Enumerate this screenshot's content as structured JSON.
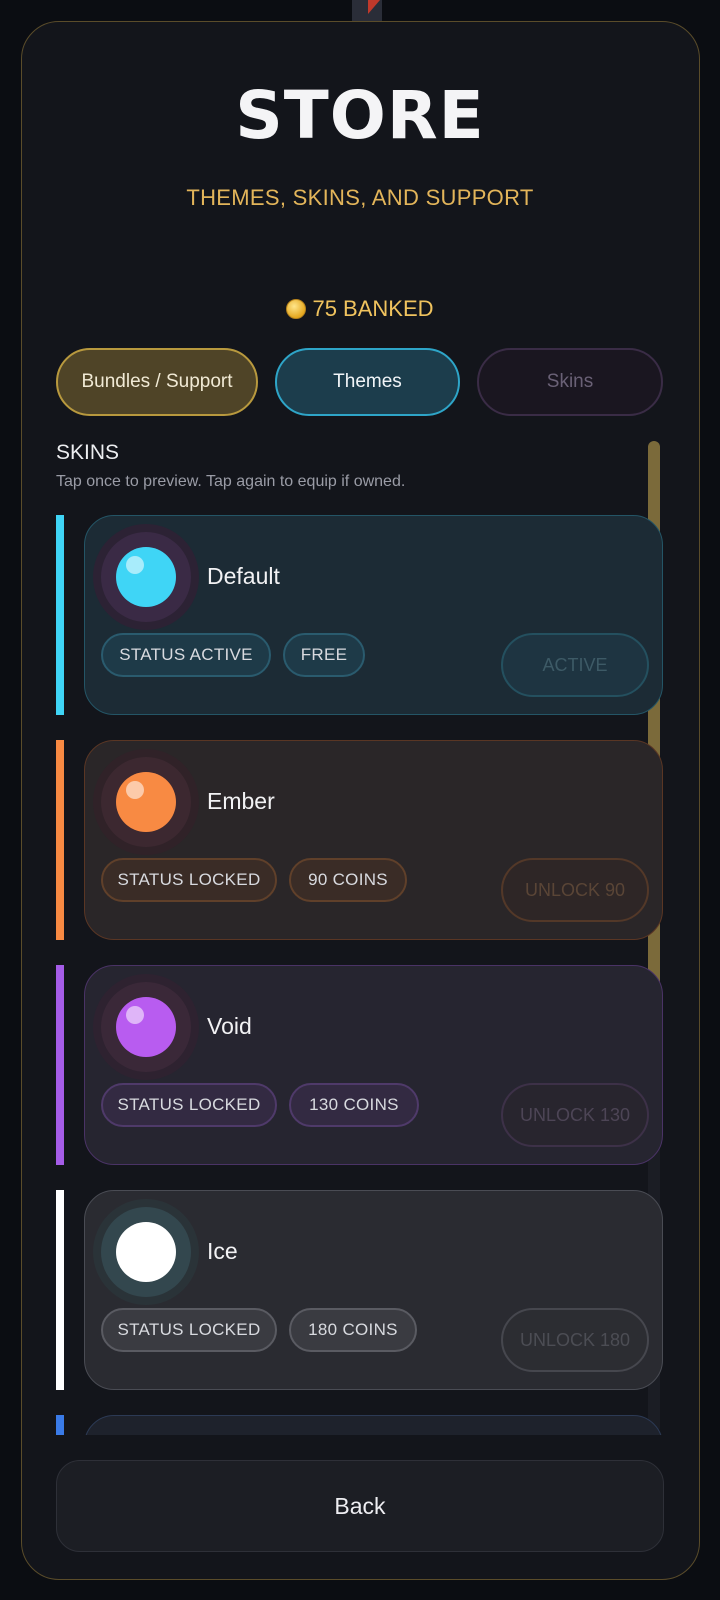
{
  "header": {
    "title": "STORE",
    "subtitle": "THEMES, SKINS, AND SUPPORT",
    "banked": "75 BANKED"
  },
  "tabs": [
    {
      "label": "Bundles / Support"
    },
    {
      "label": "Themes"
    },
    {
      "label": "Skins"
    }
  ],
  "section": {
    "title": "SKINS",
    "hint": "Tap once to preview. Tap again to equip if owned."
  },
  "skins": [
    {
      "name": "Default",
      "status": "STATUS ACTIVE",
      "price": "FREE",
      "action": "ACTIVE",
      "color": "#3fd5f6"
    },
    {
      "name": "Ember",
      "status": "STATUS LOCKED",
      "price": "90 COINS",
      "action": "UNLOCK 90",
      "color": "#f88a43"
    },
    {
      "name": "Void",
      "status": "STATUS LOCKED",
      "price": "130 COINS",
      "action": "UNLOCK 130",
      "color": "#b85cf0"
    },
    {
      "name": "Ice",
      "status": "STATUS LOCKED",
      "price": "180 COINS",
      "action": "UNLOCK 180",
      "color": "#ffffff"
    },
    {
      "name": "",
      "status": "",
      "price": "",
      "action": "",
      "color": "#3a7be8"
    }
  ],
  "footer": {
    "back_label": "Back"
  },
  "colors": {
    "accent_gold": "#e3b55a",
    "accent_cyan": "#2ea5c8",
    "panel_border": "#5a4c2a"
  }
}
